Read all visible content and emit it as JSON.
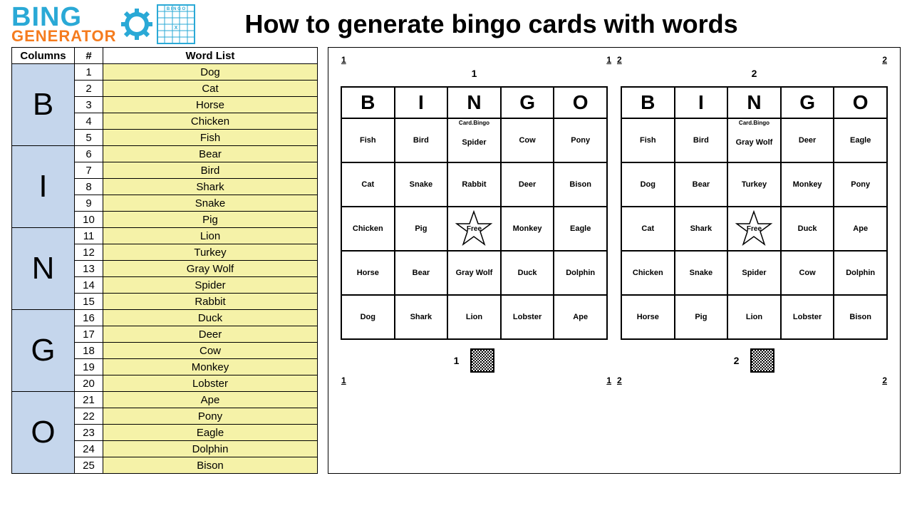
{
  "logo": {
    "line1": "BING",
    "line2": "GENERATOR"
  },
  "title": "How to generate bingo cards with words",
  "table": {
    "headers": {
      "columns": "Columns",
      "num": "#",
      "wordlist": "Word List"
    },
    "groups": [
      {
        "letter": "B",
        "rows": [
          {
            "n": "1",
            "w": "Dog"
          },
          {
            "n": "2",
            "w": "Cat"
          },
          {
            "n": "3",
            "w": "Horse"
          },
          {
            "n": "4",
            "w": "Chicken"
          },
          {
            "n": "5",
            "w": "Fish"
          }
        ]
      },
      {
        "letter": "I",
        "rows": [
          {
            "n": "6",
            "w": "Bear"
          },
          {
            "n": "7",
            "w": "Bird"
          },
          {
            "n": "8",
            "w": "Shark"
          },
          {
            "n": "9",
            "w": "Snake"
          },
          {
            "n": "10",
            "w": "Pig"
          }
        ]
      },
      {
        "letter": "N",
        "rows": [
          {
            "n": "11",
            "w": "Lion"
          },
          {
            "n": "12",
            "w": "Turkey"
          },
          {
            "n": "13",
            "w": "Gray Wolf"
          },
          {
            "n": "14",
            "w": "Spider"
          },
          {
            "n": "15",
            "w": "Rabbit"
          }
        ]
      },
      {
        "letter": "G",
        "rows": [
          {
            "n": "16",
            "w": "Duck"
          },
          {
            "n": "17",
            "w": "Deer"
          },
          {
            "n": "18",
            "w": "Cow"
          },
          {
            "n": "19",
            "w": "Monkey"
          },
          {
            "n": "20",
            "w": "Lobster"
          }
        ]
      },
      {
        "letter": "O",
        "rows": [
          {
            "n": "21",
            "w": "Ape"
          },
          {
            "n": "22",
            "w": "Pony"
          },
          {
            "n": "23",
            "w": "Eagle"
          },
          {
            "n": "24",
            "w": "Dolphin"
          },
          {
            "n": "25",
            "w": "Bison"
          }
        ]
      }
    ]
  },
  "cards": {
    "header_letters": [
      "B",
      "I",
      "N",
      "G",
      "O"
    ],
    "sublabel": "Card.Bingo",
    "free": "Free",
    "corners": {
      "tl": "1",
      "tr": "2"
    },
    "list": [
      {
        "num": "1",
        "cells": [
          [
            "Fish",
            "Bird",
            "Spider",
            "Cow",
            "Pony"
          ],
          [
            "Cat",
            "Snake",
            "Rabbit",
            "Deer",
            "Bison"
          ],
          [
            "Chicken",
            "Pig",
            "Free",
            "Monkey",
            "Eagle"
          ],
          [
            "Horse",
            "Bear",
            "Gray Wolf",
            "Duck",
            "Dolphin"
          ],
          [
            "Dog",
            "Shark",
            "Lion",
            "Lobster",
            "Ape"
          ]
        ]
      },
      {
        "num": "2",
        "cells": [
          [
            "Fish",
            "Bird",
            "Gray Wolf",
            "Deer",
            "Eagle"
          ],
          [
            "Dog",
            "Bear",
            "Turkey",
            "Monkey",
            "Pony"
          ],
          [
            "Cat",
            "Shark",
            "Free",
            "Duck",
            "Ape"
          ],
          [
            "Chicken",
            "Snake",
            "Spider",
            "Cow",
            "Dolphin"
          ],
          [
            "Horse",
            "Pig",
            "Lion",
            "Lobster",
            "Bison"
          ]
        ]
      }
    ]
  }
}
